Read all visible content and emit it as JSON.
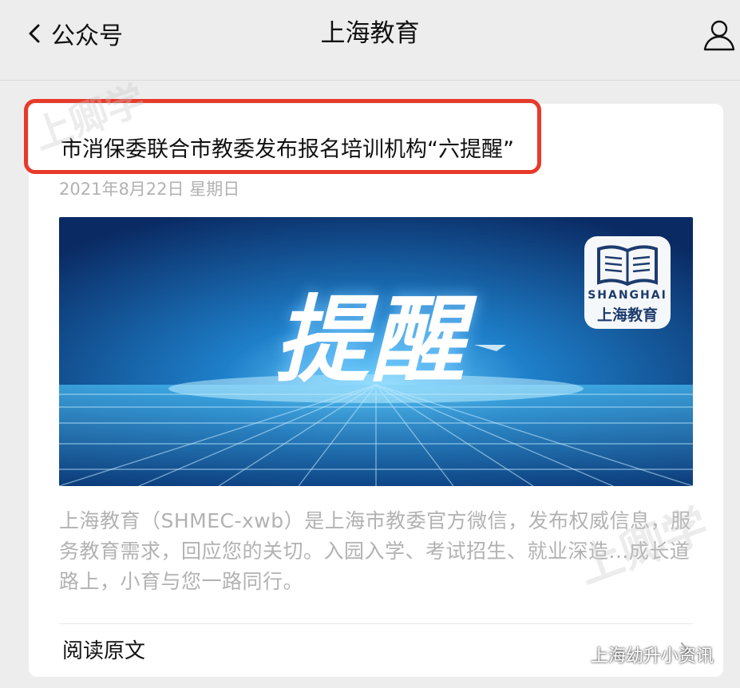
{
  "nav": {
    "back_label": "公众号",
    "title": "上海教育"
  },
  "article": {
    "title": "市消保委联合市教委发布报名培训机构“六提醒”",
    "date": "2021年8月22日 星期日",
    "cover": {
      "word": "提醒",
      "logo_latin": "SHANGHAI",
      "logo_cn": "上海教育"
    },
    "description": "上海教育（SHMEC-xwb）是上海市教委官方微信，发布权威信息，服务教育需求，回应您的关切。入园入学、考试招生、就业深造...成长道路上，小育与您一路同行。",
    "read_original": "阅读原文"
  },
  "source_watermark": "上海幼升小资讯",
  "watermark_text": "上卿学",
  "colors": {
    "highlight": "#e63a2a",
    "background": "#ededed",
    "card": "#ffffff",
    "muted_text": "#b2b2b2"
  }
}
